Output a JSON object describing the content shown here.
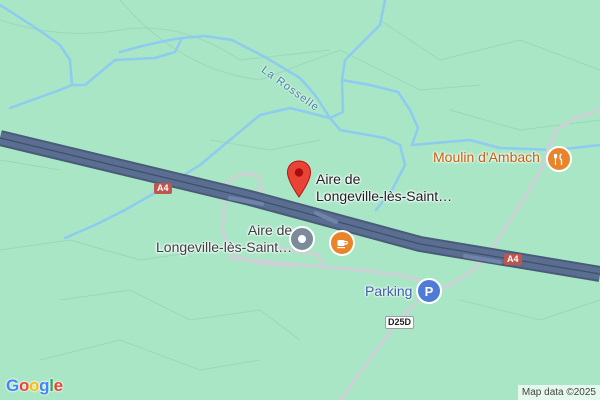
{
  "map": {
    "places": {
      "selected": {
        "line1": "Aire de",
        "line2": "Longeville-lès-Saint…",
        "icon": "red-marker-icon"
      },
      "service_area": {
        "line1": "Aire de",
        "line2": "Longeville-lès-Saint…",
        "icon": "fuel-station-icon"
      },
      "cafe": {
        "icon": "coffee-icon"
      },
      "restaurant": {
        "label": "Moulin d'Ambach",
        "icon": "restaurant-icon"
      },
      "parking": {
        "label": "Parking",
        "icon": "parking-icon"
      }
    },
    "roads": {
      "motorway_1": "A4",
      "motorway_2": "A4",
      "departmental": "D25D"
    },
    "water": {
      "river": "La Rosselle"
    },
    "branding": {
      "logo": "Google",
      "attribution": "Map data ©2025"
    },
    "colors": {
      "land": "#a8e6c5",
      "motorway": "#5a6e91",
      "water": "#8ecbf0",
      "marker": "#ea4335",
      "restaurant": "#e8842a",
      "parking": "#4e7bd6"
    }
  }
}
